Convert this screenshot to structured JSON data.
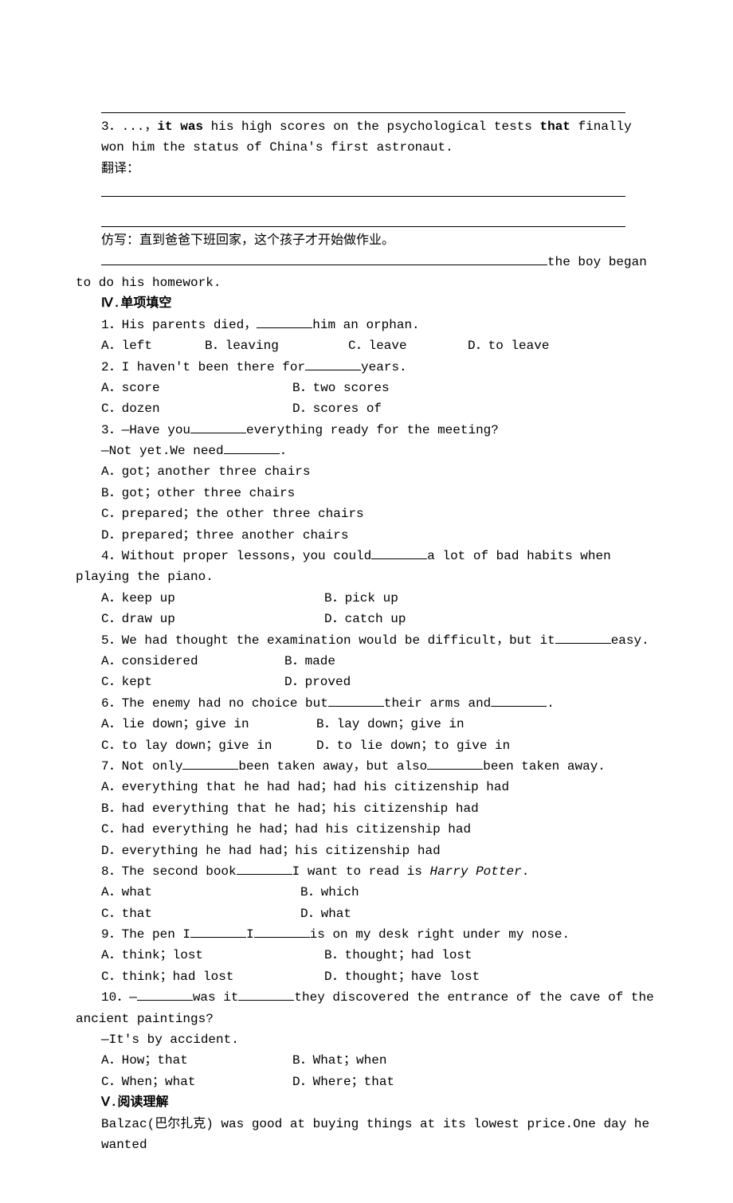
{
  "q3_text": "3．...，it was his high scores on the psychological tests that finally won him the status of China's first astronaut.",
  "q3_bold1": "it was",
  "q3_bold2": "that",
  "q3_pre": "3．...，",
  "q3_mid1": " his high scores on the psychological tests ",
  "q3_mid2": " finally won him the status of China's first astronaut.",
  "translate_label": "翻译：",
  "imitate_label": "仿写：直到爸爸下班回家，这个孩子才开始做作业。",
  "imitate_tail": "the boy began to do his homework.",
  "section4": "Ⅳ.单项填空",
  "s4": {
    "q1": "1．His parents died，",
    "q1_tail": "him an orphan.",
    "q1a": "A．left",
    "q1b": "B．leaving",
    "q1c": "C．leave",
    "q1d": "D．to leave",
    "q2": "2．I haven't been there for",
    "q2_tail": "years.",
    "q2a": "A．score",
    "q2b": "B．two scores",
    "q2c": "C．dozen",
    "q2d": "D．scores of",
    "q3": "3．—Have you",
    "q3_mid": "everything ready for the meeting?",
    "q3_2": "—Not yet.We need",
    "q3_2_tail": ".",
    "q3a": "A．got；another three chairs",
    "q3b": "B．got；other three chairs",
    "q3c": "C．prepared；the other three chairs",
    "q3d": "D．prepared；three another chairs",
    "q4": "4．Without proper lessons，you could",
    "q4_tail": "a lot of bad habits when playing the piano.",
    "q4a": "A．keep up",
    "q4b": "B．pick up",
    "q4c": "C．draw up",
    "q4d": "D．catch up",
    "q5": "5．We had thought the examination would be difficult，but it",
    "q5_tail": "easy.",
    "q5a": "A．considered",
    "q5b": "B．made",
    "q5c": "C．kept",
    "q5d": "D．proved",
    "q6": "6．The enemy had no choice but",
    "q6_mid": "their arms and",
    "q6_tail": ".",
    "q6a": "A．lie down；give in",
    "q6b": "B．lay down；give in",
    "q6c": "C．to lay down；give in",
    "q6d": "D．to lie down；to give in",
    "q7": "7．Not only",
    "q7_mid": "been taken away，but also",
    "q7_tail": "been taken away.",
    "q7a": "A．everything that he had had；had his citizenship had",
    "q7b": "B．had everything that he had；his citizenship had",
    "q7c": "C．had everything he had；had his citizenship had",
    "q7d": "D．everything he had had；his citizenship had",
    "q8": "8．The second book",
    "q8_tail": "I want to read is ",
    "q8_italic": "Harry Potter",
    "q8_period": ".",
    "q8a": "A．what",
    "q8b": "B．which",
    "q8c": "C．that",
    "q8d": "D．what",
    "q9": "9．The pen I",
    "q9_mid": "I",
    "q9_tail": "is on my desk right under my nose.",
    "q9a": "A．think；lost",
    "q9b": "B．thought；had lost",
    "q9c": "C．think；had lost",
    "q9d": "D．thought；have lost",
    "q10": "10．—",
    "q10_mid": "was it",
    "q10_tail": "they discovered the entrance of the cave of the ancient paintings?",
    "q10_2": "—It's by accident.",
    "q10a": "A．How；that",
    "q10b": "B．What；when",
    "q10c": "C．When；what",
    "q10d": "D．Where；that"
  },
  "section5": "Ⅴ.阅读理解",
  "s5_p1": "Balzac(巴尔扎克) was good at buying things at its lowest price.One day he wanted"
}
